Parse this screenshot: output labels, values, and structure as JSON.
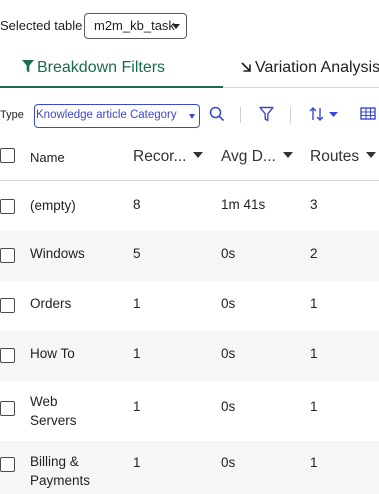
{
  "header": {
    "selected_table_label": "Selected table",
    "selected_table_value": "m2m_kb_task"
  },
  "tabs": [
    {
      "label": "Breakdown Filters",
      "active": true,
      "icon": "filter-icon"
    },
    {
      "label": "Variation Analysis",
      "active": false,
      "icon": "arrow-down-right-icon"
    }
  ],
  "toolbar": {
    "type_label": "Type",
    "type_value": "Knowledge article Category",
    "icons": [
      "search-icon",
      "filter-icon",
      "sort-icon",
      "table-settings-icon"
    ]
  },
  "table": {
    "columns": [
      "Name",
      "Recor...",
      "Avg D...",
      "Routes"
    ],
    "rows": [
      {
        "name": "(empty)",
        "records": "8",
        "avg": "1m 41s",
        "routes": "3"
      },
      {
        "name": "Windows",
        "records": "5",
        "avg": "0s",
        "routes": "2"
      },
      {
        "name": "Orders",
        "records": "1",
        "avg": "0s",
        "routes": "1"
      },
      {
        "name": "How To",
        "records": "1",
        "avg": "0s",
        "routes": "1"
      },
      {
        "name": "Web Servers",
        "records": "1",
        "avg": "0s",
        "routes": "1"
      },
      {
        "name": "Billing & Payments",
        "records": "1",
        "avg": "0s",
        "routes": "1"
      }
    ]
  },
  "colors": {
    "accent_green": "#1a6b51",
    "accent_blue": "#3b48d1",
    "row_alt": "#f6f6f6"
  }
}
